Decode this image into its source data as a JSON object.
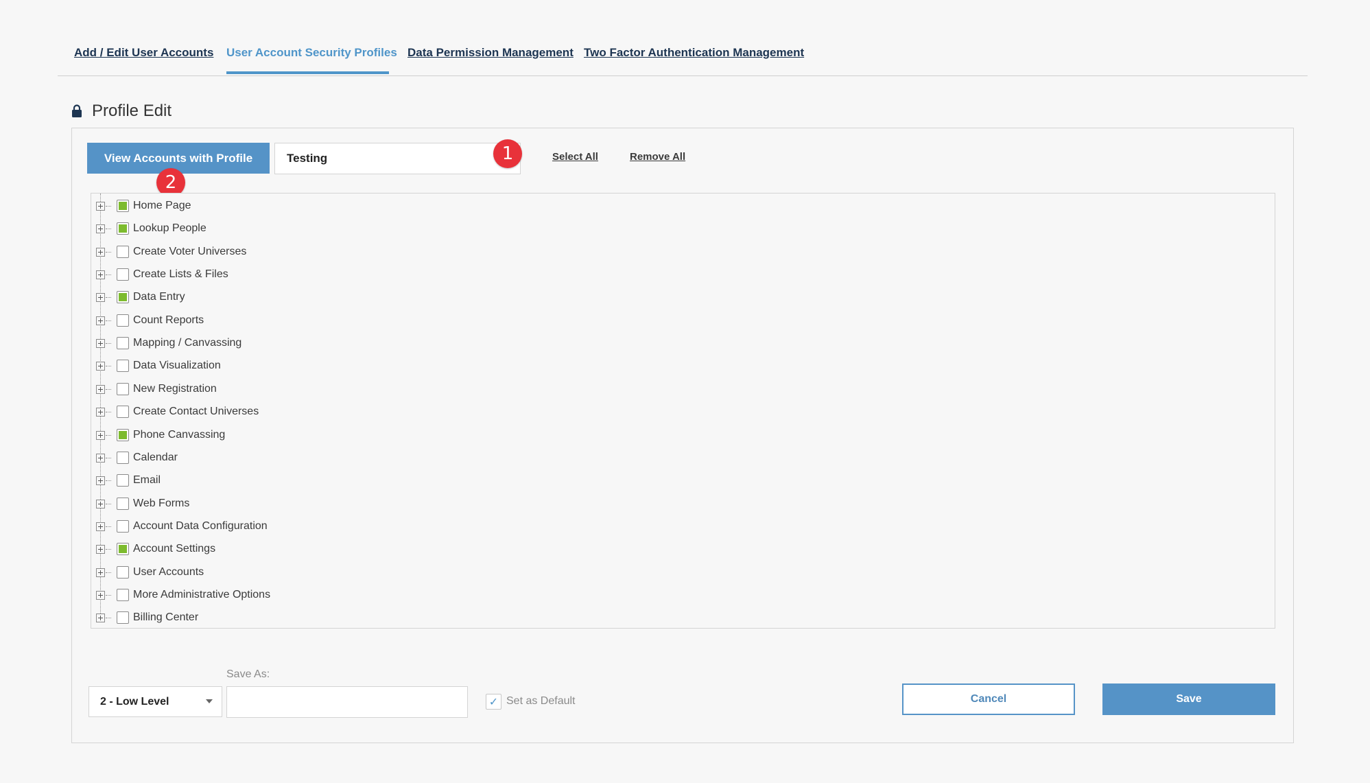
{
  "tabs": [
    {
      "label": "Add / Edit User Accounts",
      "active": false
    },
    {
      "label": "User Account Security Profiles",
      "active": true
    },
    {
      "label": "Data Permission Management",
      "active": false
    },
    {
      "label": "Two Factor Authentication Management",
      "active": false
    }
  ],
  "page": {
    "title": "Profile Edit",
    "icon": "lock-icon"
  },
  "toolbar": {
    "view_accounts_label": "View Accounts with Profile",
    "profile_name_value": "Testing",
    "select_all_label": "Select All",
    "remove_all_label": "Remove All"
  },
  "annotations": {
    "badge_1": "1",
    "badge_2": "2"
  },
  "tree": {
    "items": [
      {
        "label": "Home Page",
        "checked": true
      },
      {
        "label": "Lookup People",
        "checked": true
      },
      {
        "label": "Create Voter Universes",
        "checked": false
      },
      {
        "label": "Create Lists & Files",
        "checked": false
      },
      {
        "label": "Data Entry",
        "checked": true
      },
      {
        "label": "Count Reports",
        "checked": false
      },
      {
        "label": "Mapping / Canvassing",
        "checked": false
      },
      {
        "label": "Data Visualization",
        "checked": false
      },
      {
        "label": "New Registration",
        "checked": false
      },
      {
        "label": "Create Contact Universes",
        "checked": false
      },
      {
        "label": "Phone Canvassing",
        "checked": true
      },
      {
        "label": "Calendar",
        "checked": false
      },
      {
        "label": "Email",
        "checked": false
      },
      {
        "label": "Web Forms",
        "checked": false
      },
      {
        "label": "Account Data Configuration",
        "checked": false
      },
      {
        "label": "Account Settings",
        "checked": true
      },
      {
        "label": "User Accounts",
        "checked": false
      },
      {
        "label": "More Administrative Options",
        "checked": false
      },
      {
        "label": "Billing Center",
        "checked": false
      }
    ]
  },
  "footer": {
    "level_select_value": "2 - Low Level",
    "save_as_label": "Save As:",
    "save_as_value": "",
    "set_default_label": "Set as Default",
    "set_default_checked": true,
    "cancel_label": "Cancel",
    "save_label": "Save"
  },
  "colors": {
    "accent": "#5593c7",
    "tab_active": "#4f95c9",
    "checked_fill": "#7dbb2e",
    "badge": "#e8323a"
  }
}
